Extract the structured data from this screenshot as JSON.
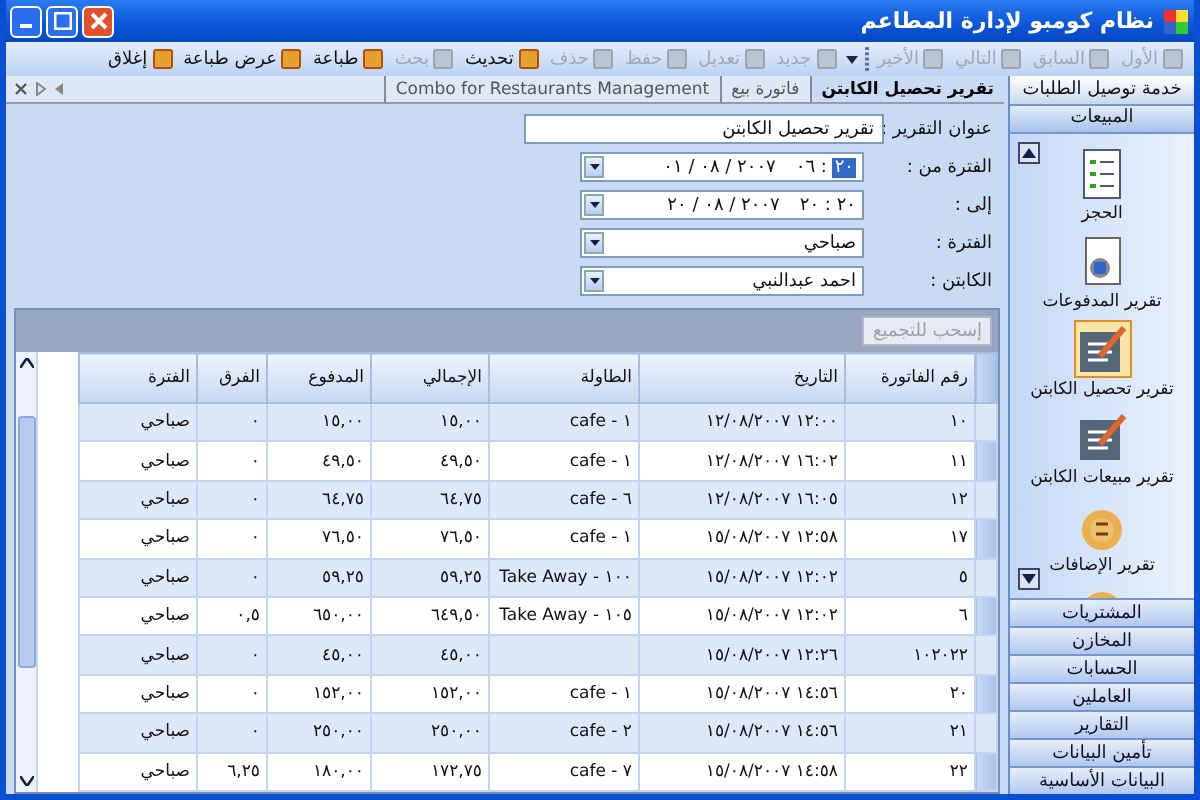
{
  "window": {
    "title": "نظام كومبو لإدارة المطاعم"
  },
  "toolbar": {
    "items": [
      {
        "kind": "button",
        "label": "الأول",
        "disabled": true
      },
      {
        "kind": "button",
        "label": "السابق",
        "disabled": true
      },
      {
        "kind": "button",
        "label": "التالي",
        "disabled": true
      },
      {
        "kind": "button",
        "label": "الأخير",
        "disabled": true
      },
      {
        "kind": "separator"
      },
      {
        "kind": "menu"
      },
      {
        "kind": "button",
        "label": "جديد",
        "disabled": true
      },
      {
        "kind": "button",
        "label": "تعديل",
        "disabled": true
      },
      {
        "kind": "button",
        "label": "حفظ",
        "disabled": true
      },
      {
        "kind": "button",
        "label": "حذف",
        "disabled": true
      },
      {
        "kind": "button",
        "label": "تحديث",
        "disabled": false
      },
      {
        "kind": "button",
        "label": "بحث",
        "disabled": true
      },
      {
        "kind": "button",
        "label": "طباعة",
        "disabled": false
      },
      {
        "kind": "button",
        "label": "عرض طباعة",
        "disabled": false
      },
      {
        "kind": "button",
        "label": "إغلاق",
        "disabled": false
      }
    ]
  },
  "tabs": [
    {
      "label": "تقرير تحصيل الكابتن",
      "selected": true
    },
    {
      "label": "فاتورة بيع",
      "selected": false
    },
    {
      "label": "Combo for Restaurants Management",
      "selected": false
    }
  ],
  "form": {
    "title_label": "عنوان التقرير :",
    "title_value": "تقرير تحصيل الكابتن",
    "from_label": "الفترة من :",
    "from_hour": "٢٠",
    "from_separator": ":",
    "from_minute": "٠٦",
    "from_date": "٢٠٠٧ / ٠٨ / ٠١",
    "to_label": "إلى :",
    "to_hour": "٢٠",
    "to_separator": ":",
    "to_minute": "٢٠",
    "to_date": "٢٠٠٧ / ٠٨ / ٢٠",
    "shift_label": "الفترة :",
    "shift_value": "صباحي",
    "captain_label": "الكابتن :",
    "captain_value": "احمد عبدالنبي"
  },
  "grid": {
    "group_button": "إسحب للتجميع",
    "columns": [
      "رقم الفاتورة",
      "التاريخ",
      "الطاولة",
      "الإجمالي",
      "المدفوع",
      "الفرق",
      "الفترة"
    ],
    "rows": [
      [
        "١٠",
        "١٢:٠٠ ١٢/٠٨/٢٠٠٧",
        "cafe - ١",
        "١٥,٠٠",
        "١٥,٠٠",
        "٠",
        "صباحي"
      ],
      [
        "١١",
        "١٦:٠٢ ١٢/٠٨/٢٠٠٧",
        "cafe - ١",
        "٤٩,٥٠",
        "٤٩,٥٠",
        "٠",
        "صباحي"
      ],
      [
        "١٢",
        "١٦:٠٥ ١٢/٠٨/٢٠٠٧",
        "cafe - ٦",
        "٦٤,٧٥",
        "٦٤,٧٥",
        "٠",
        "صباحي"
      ],
      [
        "١٧",
        "١٢:٥٨ ١٥/٠٨/٢٠٠٧",
        "cafe - ١",
        "٧٦,٥٠",
        "٧٦,٥٠",
        "٠",
        "صباحي"
      ],
      [
        "٥",
        "١٢:٠٢ ١٥/٠٨/٢٠٠٧",
        "Take Away - ١٠٠",
        "٥٩,٢٥",
        "٥٩,٢٥",
        "٠",
        "صباحي"
      ],
      [
        "٦",
        "١٢:٠٢ ١٥/٠٨/٢٠٠٧",
        "Take Away - ١٠٥",
        "٦٤٩,٥٠",
        "٦٥٠,٠٠",
        "٠,٥",
        "صباحي"
      ],
      [
        "١٠٢٠٢٢",
        "١٢:٢٦ ١٥/٠٨/٢٠٠٧",
        "",
        "٤٥,٠٠",
        "٤٥,٠٠",
        "٠",
        "صباحي"
      ],
      [
        "٢٠",
        "١٤:٥٦ ١٥/٠٨/٢٠٠٧",
        "cafe - ١",
        "١٥٢,٠٠",
        "١٥٢,٠٠",
        "٠",
        "صباحي"
      ],
      [
        "٢١",
        "١٤:٥٦ ١٥/٠٨/٢٠٠٧",
        "cafe - ٢",
        "٢٥٠,٠٠",
        "٢٥٠,٠٠",
        "٠",
        "صباحي"
      ],
      [
        "٢٢",
        "١٤:٥٨ ١٥/٠٨/٢٠٠٧",
        "cafe - ٧",
        "١٧٢,٧٥",
        "١٨٠,٠٠",
        "٦,٢٥",
        "صباحي"
      ]
    ]
  },
  "sidebar": {
    "header": "خدمة توصيل الطلبات",
    "section": "المبيعات",
    "items": [
      {
        "label": "الحجز",
        "selected": false
      },
      {
        "label": "تقرير المدفوعات",
        "selected": false
      },
      {
        "label": "تقرير تحصيل الكابتن",
        "selected": true
      },
      {
        "label": "تقرير مبيعات الكابتن",
        "selected": false
      },
      {
        "label": "تقرير الإضافات",
        "selected": false
      }
    ],
    "sections": [
      "المشتريات",
      "المخازن",
      "الحسابات",
      "العاملين",
      "التقارير",
      "تأمين البيانات",
      "البيانات الأساسية"
    ]
  }
}
